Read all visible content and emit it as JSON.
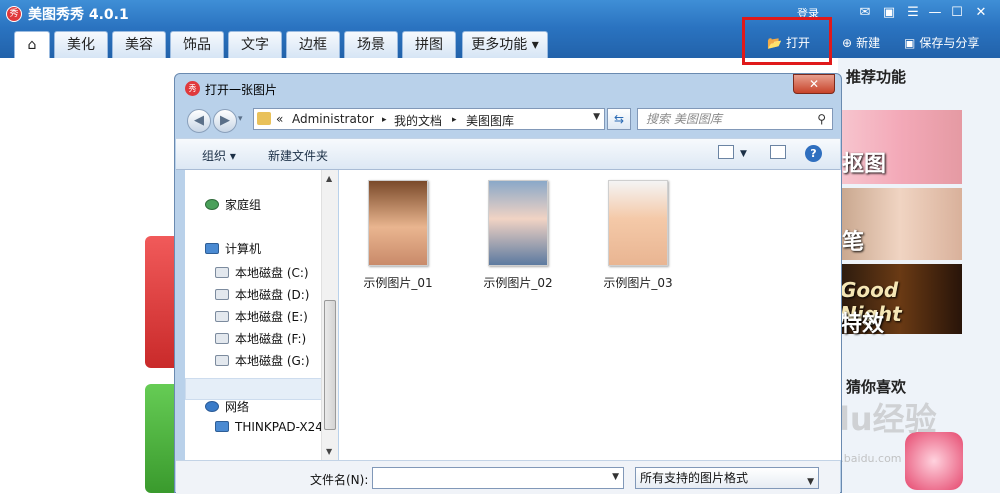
{
  "app": {
    "title": "美图秀秀 4.0.1",
    "login": "登录",
    "logo_glyph": "秀"
  },
  "titlebar_icons": [
    "message-icon",
    "skin-icon",
    "menu-icon",
    "minimize-icon",
    "maximize-icon",
    "close-icon"
  ],
  "tabs": {
    "home_glyph": "⌂",
    "items": [
      "美化",
      "美容",
      "饰品",
      "文字",
      "边框",
      "场景",
      "拼图",
      "更多功能"
    ]
  },
  "toolbar": {
    "open": "打开",
    "new": "新建",
    "save": "保存与分享"
  },
  "right_panel": {
    "recommend": "推荐功能",
    "guess": "猜你喜欢",
    "thumb1_label": "抠图",
    "thumb2_label": "笔",
    "thumb3_label": "Good Night",
    "thumb3_label2": "特效"
  },
  "dialog": {
    "title": "打开一张图片",
    "close": "✕",
    "breadcrumbs": [
      "«",
      "Administrator",
      "▸",
      "我的文档",
      "▸",
      "美图图库"
    ],
    "search_placeholder": "搜索 美图图库",
    "organize": "组织 ▾",
    "new_folder": "新建文件夹",
    "nav": {
      "homegroup": "家庭组",
      "computer": "计算机",
      "drives": [
        "本地磁盘 (C:)",
        "本地磁盘 (D:)",
        "本地磁盘 (E:)",
        "本地磁盘 (F:)",
        "本地磁盘 (G:)"
      ],
      "network": "网络",
      "network_pc": "THINKPAD-X24"
    },
    "files": [
      "示例图片_01",
      "示例图片_02",
      "示例图片_03"
    ],
    "filename_label": "文件名(N):",
    "filename_value": "",
    "filter": "所有支持的图片格式"
  },
  "watermark": {
    "text": "Baidu经验",
    "url": "jingyan.baidu.com"
  },
  "colors": {
    "titlebar": "#2a73c0",
    "highlight": "#e0191a"
  }
}
